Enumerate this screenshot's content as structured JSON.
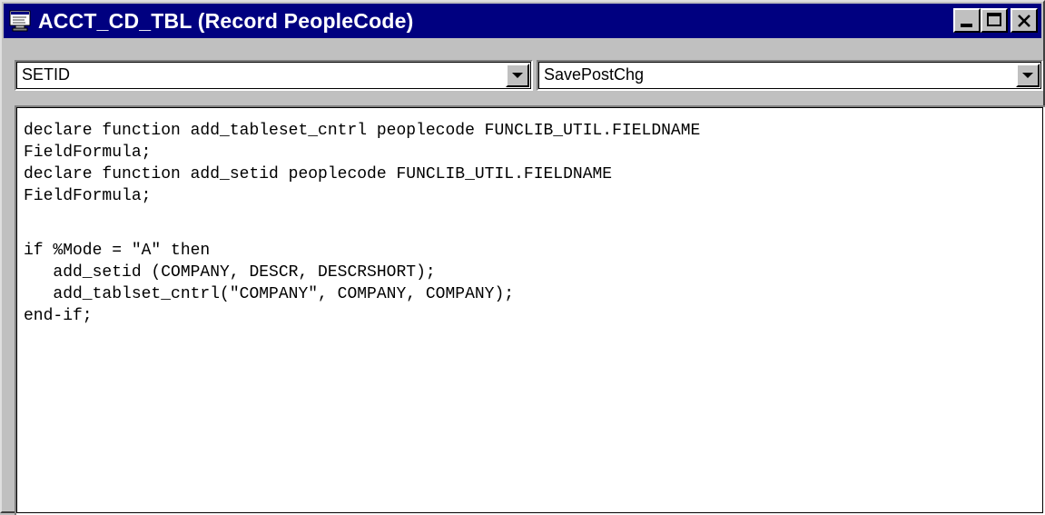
{
  "window": {
    "title": "ACCT_CD_TBL (Record PeopleCode)",
    "icon": "peoplecode-editor-icon",
    "buttons": {
      "minimize_icon": "minimize-icon",
      "maximize_icon": "maximize-icon",
      "close_icon": "close-icon"
    },
    "titlebar_color": "#000080"
  },
  "toolbar": {
    "field_select": {
      "value": "SETID"
    },
    "event_select": {
      "value": "SavePostChg"
    }
  },
  "editor": {
    "lines": [
      "declare function add_tableset_cntrl peoplecode FUNCLIB_UTIL.FIELDNAME",
      "FieldFormula;",
      "declare function add_setid peoplecode FUNCLIB_UTIL.FIELDNAME",
      "FieldFormula;",
      "",
      "if %Mode = \"A\" then",
      "   add_setid (COMPANY, DESCR, DESCRSHORT);",
      "   add_tablset_cntrl(\"COMPANY\", COMPANY, COMPANY);",
      "end-if;"
    ]
  }
}
